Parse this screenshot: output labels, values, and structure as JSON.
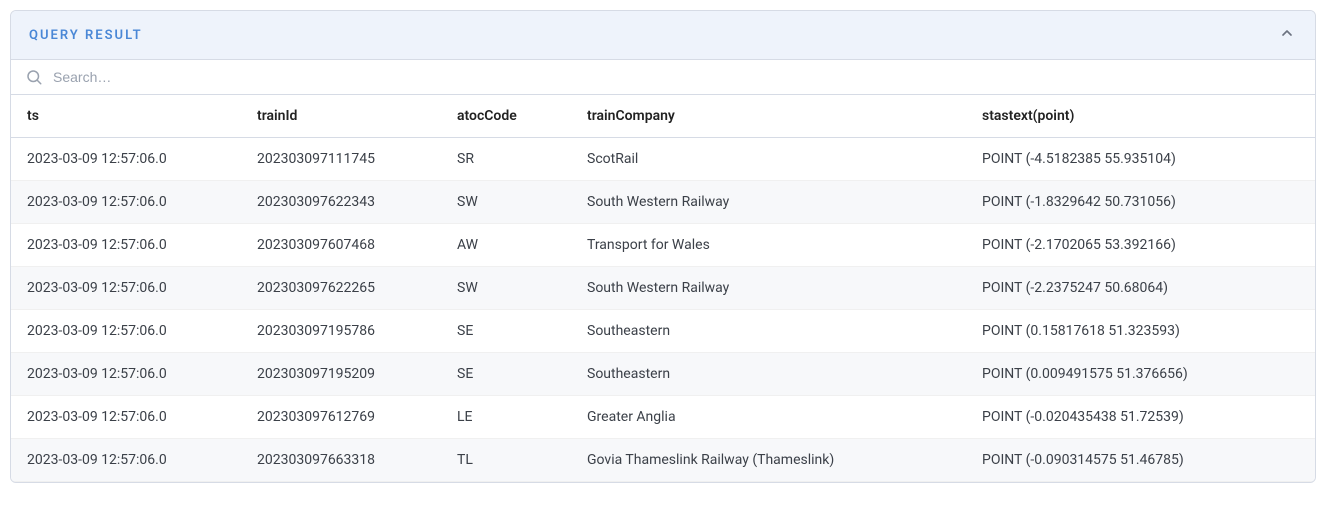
{
  "panel": {
    "title": "QUERY RESULT"
  },
  "search": {
    "placeholder": "Search…",
    "value": ""
  },
  "table": {
    "columns": {
      "ts": "ts",
      "trainId": "trainId",
      "atocCode": "atocCode",
      "trainCompany": "trainCompany",
      "point": "stastext(point)"
    },
    "rows": [
      {
        "ts": "2023-03-09 12:57:06.0",
        "trainId": "202303097111745",
        "atocCode": "SR",
        "trainCompany": "ScotRail",
        "point": "POINT (-4.5182385 55.935104)"
      },
      {
        "ts": "2023-03-09 12:57:06.0",
        "trainId": "202303097622343",
        "atocCode": "SW",
        "trainCompany": "South Western Railway",
        "point": "POINT (-1.8329642 50.731056)"
      },
      {
        "ts": "2023-03-09 12:57:06.0",
        "trainId": "202303097607468",
        "atocCode": "AW",
        "trainCompany": "Transport for Wales",
        "point": "POINT (-2.1702065 53.392166)"
      },
      {
        "ts": "2023-03-09 12:57:06.0",
        "trainId": "202303097622265",
        "atocCode": "SW",
        "trainCompany": "South Western Railway",
        "point": "POINT (-2.2375247 50.68064)"
      },
      {
        "ts": "2023-03-09 12:57:06.0",
        "trainId": "202303097195786",
        "atocCode": "SE",
        "trainCompany": "Southeastern",
        "point": "POINT (0.15817618 51.323593)"
      },
      {
        "ts": "2023-03-09 12:57:06.0",
        "trainId": "202303097195209",
        "atocCode": "SE",
        "trainCompany": "Southeastern",
        "point": "POINT (0.009491575 51.376656)"
      },
      {
        "ts": "2023-03-09 12:57:06.0",
        "trainId": "202303097612769",
        "atocCode": "LE",
        "trainCompany": "Greater Anglia",
        "point": "POINT (-0.020435438 51.72539)"
      },
      {
        "ts": "2023-03-09 12:57:06.0",
        "trainId": "202303097663318",
        "atocCode": "TL",
        "trainCompany": "Govia Thameslink Railway (Thameslink)",
        "point": "POINT (-0.090314575 51.46785)"
      }
    ]
  }
}
